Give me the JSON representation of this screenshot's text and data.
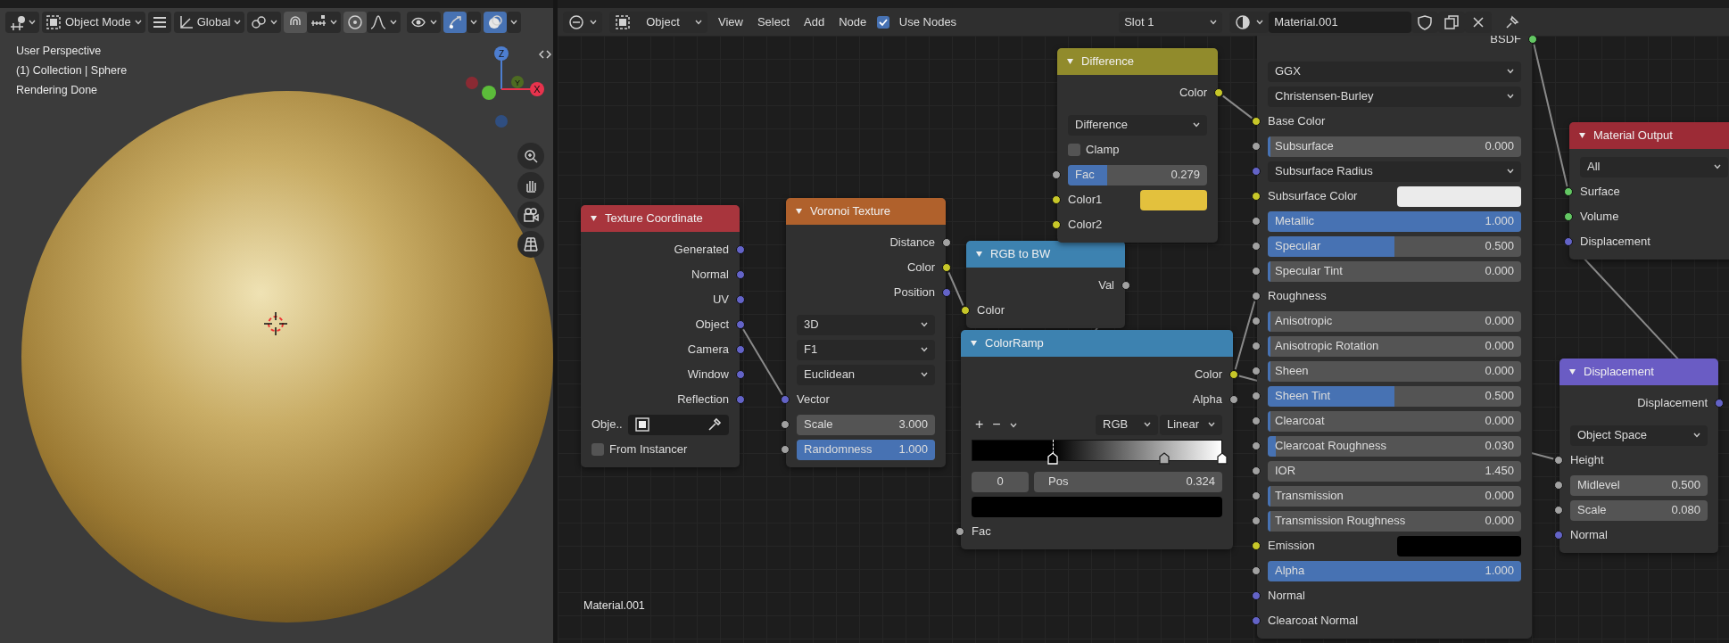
{
  "viewport": {
    "header": {
      "mode": "Object Mode",
      "orientation": "Global",
      "snap_on": false,
      "proportional_on": false,
      "gizmos_on": true,
      "overlays_on": true
    },
    "overlay_text": [
      "User Perspective",
      "(1) Collection | Sphere",
      "Rendering Done"
    ],
    "axes": [
      "Z",
      "Y",
      "X"
    ]
  },
  "node_editor": {
    "header": {
      "editor_mode": "Object",
      "menus": [
        "View",
        "Select",
        "Add",
        "Node"
      ],
      "use_nodes": {
        "label": "Use Nodes",
        "checked": true
      },
      "slot": "Slot 1",
      "material": "Material.001"
    },
    "frame_label": "Material.001",
    "nodes": [
      {
        "title": "Texture Coordinate",
        "color": "#a8353d",
        "rows": [
          {
            "kind": "output",
            "label": "Generated",
            "socket": {
              "color": "#6363c7"
            }
          },
          {
            "kind": "output",
            "label": "Normal",
            "socket": {
              "color": "#6363c7"
            }
          },
          {
            "kind": "output",
            "label": "UV",
            "socket": {
              "color": "#6363c7"
            }
          },
          {
            "kind": "output",
            "label": "Object",
            "socket": {
              "color": "#6363c7"
            }
          },
          {
            "kind": "output",
            "label": "Camera",
            "socket": {
              "color": "#6363c7"
            }
          },
          {
            "kind": "output",
            "label": "Window",
            "socket": {
              "color": "#6363c7"
            }
          },
          {
            "kind": "output",
            "label": "Reflection",
            "socket": {
              "color": "#6363c7"
            }
          },
          {
            "kind": "object",
            "label": "Obje.."
          },
          {
            "kind": "checkbox",
            "label": "From Instancer",
            "checked": false
          }
        ]
      },
      {
        "title": "Voronoi Texture",
        "color": "#b0612c",
        "rows": [
          {
            "kind": "output",
            "label": "Distance",
            "socket": {
              "color": "#a1a1a1"
            }
          },
          {
            "kind": "output",
            "label": "Color",
            "socket": {
              "color": "#c7c729"
            }
          },
          {
            "kind": "output",
            "label": "Position",
            "socket": {
              "color": "#6363c7"
            }
          },
          {
            "kind": "dropdown",
            "label": "3D"
          },
          {
            "kind": "dropdown",
            "label": "F1"
          },
          {
            "kind": "dropdown",
            "label": "Euclidean"
          },
          {
            "kind": "input",
            "label": "Vector",
            "socket": {
              "color": "#6363c7"
            }
          },
          {
            "kind": "number",
            "label": "Scale",
            "value": "3.000",
            "socket": {
              "color": "#a1a1a1"
            }
          },
          {
            "kind": "slider",
            "label": "Randomness",
            "value": "1.000",
            "level": 1,
            "socket": {
              "color": "#a1a1a1"
            }
          }
        ]
      },
      {
        "title": "RGB to BW",
        "color": "#3d82b0",
        "rows": [
          {
            "kind": "output",
            "label": "Val",
            "socket": {
              "color": "#a1a1a1"
            }
          },
          {
            "kind": "input",
            "label": "Color",
            "socket": {
              "color": "#c7c729"
            }
          }
        ]
      },
      {
        "title": "Difference",
        "color": "#918b2c",
        "rows": [
          {
            "kind": "output",
            "label": "Color",
            "socket": {
              "color": "#c7c729"
            }
          },
          {
            "kind": "dropdown",
            "label": "Difference"
          },
          {
            "kind": "checkbox",
            "label": "Clamp",
            "checked": false
          },
          {
            "kind": "slider",
            "label": "Fac",
            "value": "0.279",
            "level": 0.279,
            "socket": {
              "color": "#a1a1a1"
            }
          },
          {
            "kind": "color",
            "label": "Color1",
            "color": "#e3c13d",
            "socket": {
              "color": "#c7c729"
            }
          },
          {
            "kind": "input",
            "label": "Color2",
            "socket": {
              "color": "#c7c729"
            }
          }
        ]
      },
      {
        "title": "ColorRamp",
        "color": "#3d82b0",
        "rows": [
          {
            "kind": "output",
            "label": "Color",
            "socket": {
              "color": "#c7c729"
            }
          },
          {
            "kind": "output",
            "label": "Alpha",
            "socket": {
              "color": "#a1a1a1"
            }
          },
          {
            "kind": "ramp_tools",
            "buttons": [
              "+",
              "−"
            ],
            "dropdowns": [
              "RGB",
              "Linear"
            ]
          },
          {
            "kind": "ramp",
            "stops": [
              {
                "level": 0.324,
                "color": "#000000",
                "selected": true
              },
              {
                "level": 0.77,
                "color": "#a9a9a9",
                "selected": false
              },
              {
                "level": 1,
                "color": "#ffffff",
                "selected": false
              }
            ]
          },
          {
            "kind": "ramp_fields",
            "index": "0",
            "pos_label": "Pos",
            "pos_value": "0.324"
          },
          {
            "kind": "swatch",
            "color": "#000000"
          },
          {
            "kind": "input",
            "label": "Fac",
            "socket": {
              "color": "#a1a1a1"
            }
          }
        ]
      },
      {
        "rows": [
          {
            "kind": "output",
            "label": "BSDF",
            "socket": {
              "color": "#63c763"
            }
          },
          {
            "kind": "dropdown",
            "label": "GGX"
          },
          {
            "kind": "dropdown",
            "label": "Christensen-Burley"
          },
          {
            "kind": "input",
            "label": "Base Color",
            "socket": {
              "color": "#c7c729"
            }
          },
          {
            "kind": "slider",
            "label": "Subsurface",
            "value": "0.000",
            "level": 0,
            "socket": {
              "color": "#a1a1a1"
            }
          },
          {
            "kind": "dropdown",
            "label": "Subsurface Radius",
            "socket": {
              "color": "#6363c7"
            }
          },
          {
            "kind": "color",
            "label": "Subsurface Color",
            "color": "#ebebeb",
            "socket": {
              "color": "#c7c729"
            }
          },
          {
            "kind": "slider",
            "label": "Metallic",
            "value": "1.000",
            "level": 1,
            "socket": {
              "color": "#a1a1a1"
            }
          },
          {
            "kind": "slider",
            "label": "Specular",
            "value": "0.500",
            "level": 0.5,
            "socket": {
              "color": "#a1a1a1"
            }
          },
          {
            "kind": "slider",
            "label": "Specular Tint",
            "value": "0.000",
            "level": 0,
            "socket": {
              "color": "#a1a1a1"
            }
          },
          {
            "kind": "input",
            "label": "Roughness",
            "socket": {
              "color": "#a1a1a1"
            }
          },
          {
            "kind": "slider",
            "label": "Anisotropic",
            "value": "0.000",
            "level": 0,
            "socket": {
              "color": "#a1a1a1"
            }
          },
          {
            "kind": "slider",
            "label": "Anisotropic Rotation",
            "value": "0.000",
            "level": 0,
            "socket": {
              "color": "#a1a1a1"
            }
          },
          {
            "kind": "slider",
            "label": "Sheen",
            "value": "0.000",
            "level": 0,
            "socket": {
              "color": "#a1a1a1"
            }
          },
          {
            "kind": "slider",
            "label": "Sheen Tint",
            "value": "0.500",
            "level": 0.5,
            "socket": {
              "color": "#a1a1a1"
            }
          },
          {
            "kind": "slider",
            "label": "Clearcoat",
            "value": "0.000",
            "level": 0,
            "socket": {
              "color": "#a1a1a1"
            }
          },
          {
            "kind": "slider",
            "label": "Clearcoat Roughness",
            "value": "0.030",
            "level": 0.03,
            "socket": {
              "color": "#a1a1a1"
            }
          },
          {
            "kind": "number",
            "label": "IOR",
            "value": "1.450",
            "socket": {
              "color": "#a1a1a1"
            }
          },
          {
            "kind": "slider",
            "label": "Transmission",
            "value": "0.000",
            "level": 0,
            "socket": {
              "color": "#a1a1a1"
            }
          },
          {
            "kind": "slider",
            "label": "Transmission Roughness",
            "value": "0.000",
            "level": 0,
            "socket": {
              "color": "#a1a1a1"
            }
          },
          {
            "kind": "color",
            "label": "Emission",
            "color": "#000000",
            "socket": {
              "color": "#c7c729"
            }
          },
          {
            "kind": "slider",
            "label": "Alpha",
            "value": "1.000",
            "level": 1,
            "socket": {
              "color": "#a1a1a1"
            }
          },
          {
            "kind": "input",
            "label": "Normal",
            "socket": {
              "color": "#6363c7"
            }
          },
          {
            "kind": "input",
            "label": "Clearcoat Normal",
            "socket": {
              "color": "#6363c7"
            }
          }
        ]
      },
      {
        "title": "Material Output",
        "color": "#9c2b36",
        "rows": [
          {
            "kind": "dropdown",
            "label": "All"
          },
          {
            "kind": "input",
            "label": "Surface",
            "socket": {
              "color": "#63c763"
            }
          },
          {
            "kind": "input",
            "label": "Volume",
            "socket": {
              "color": "#63c763"
            }
          },
          {
            "kind": "input",
            "label": "Displacement",
            "socket": {
              "color": "#6363c7"
            }
          }
        ]
      },
      {
        "title": "Displacement",
        "color": "#6a5cc4",
        "rows": [
          {
            "kind": "output",
            "label": "Displacement",
            "socket": {
              "color": "#6363c7"
            }
          },
          {
            "kind": "dropdown",
            "label": "Object Space"
          },
          {
            "kind": "input",
            "label": "Height",
            "socket": {
              "color": "#a1a1a1"
            }
          },
          {
            "kind": "number",
            "label": "Midlevel",
            "value": "0.500",
            "socket": {
              "color": "#a1a1a1"
            }
          },
          {
            "kind": "number",
            "label": "Scale",
            "value": "0.080",
            "socket": {
              "color": "#a1a1a1"
            }
          },
          {
            "kind": "input",
            "label": "Normal",
            "socket": {
              "color": "#6363c7"
            }
          }
        ]
      }
    ]
  }
}
